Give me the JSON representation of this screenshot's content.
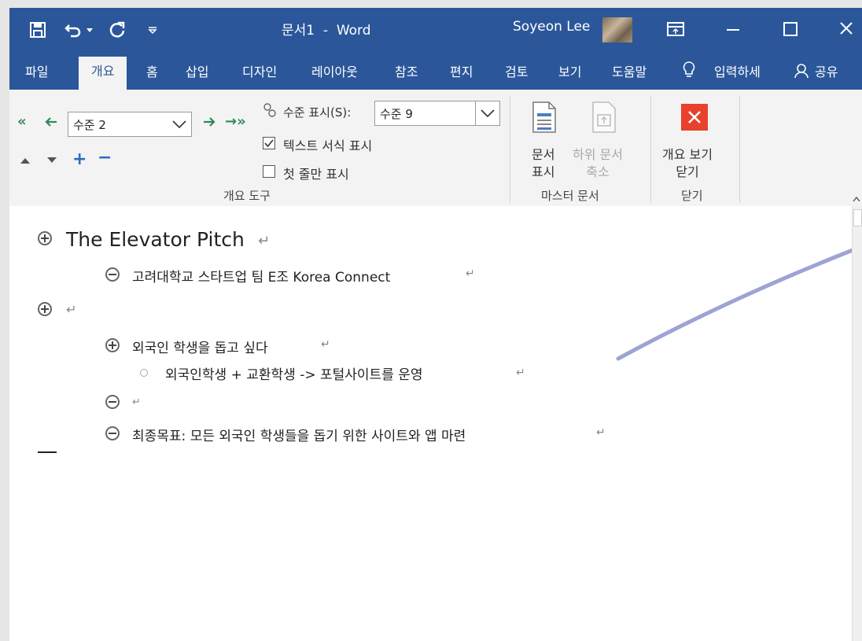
{
  "title_bar": {
    "doc_title": "문서1  -  Word",
    "user_name": "Soyeon Lee"
  },
  "tabs": [
    "파일",
    "개요",
    "홈",
    "삽입",
    "디자인",
    "레이아웃",
    "참조",
    "편지",
    "검토",
    "보기",
    "도움말"
  ],
  "tell_me": "입력하세",
  "share": "공유",
  "outline_tools": {
    "level_value": "수준 2",
    "show_level_label": "수준 표시(S):",
    "show_level_value": "수준 9",
    "show_text_formatting": "텍스트 서식 표시",
    "show_first_line_only": "첫 줄만 표시",
    "group_label": "개요 도구"
  },
  "master_document": {
    "show_document": "문서\n표시",
    "collapse_subdocuments": "하위 문서\n축소",
    "group_label": "마스터 문서"
  },
  "close_group": {
    "close_outline_view": "개요 보기\n닫기",
    "group_label": "닫기"
  },
  "document": {
    "lines": [
      {
        "symbol": "plus",
        "text": "The Elevator Pitch",
        "mark": "↵"
      },
      {
        "symbol": "minus",
        "text": "고려대학교 스타트업 팀 E조 Korea Connect",
        "mark": "↵"
      },
      {
        "symbol": "plus",
        "text": "",
        "mark": "↵"
      },
      {
        "symbol": "plus",
        "text": "외국인 학생을 돕고 싶다",
        "mark": "↵"
      },
      {
        "symbol": "dot",
        "text": "외국인학생 + 교환학생 -> 포털사이트를 운영",
        "mark": "↵"
      },
      {
        "symbol": "minus",
        "text": "",
        "mark": "↵"
      },
      {
        "symbol": "minus",
        "text": "최종목표: 모든 외국인 학생들을 돕기 위한 사이트와 앱 마련",
        "mark": "↵"
      }
    ]
  },
  "colors": {
    "title_bar": "#2b579a",
    "ribbon": "#f3f3f3",
    "close_outline": "#e8412c"
  }
}
